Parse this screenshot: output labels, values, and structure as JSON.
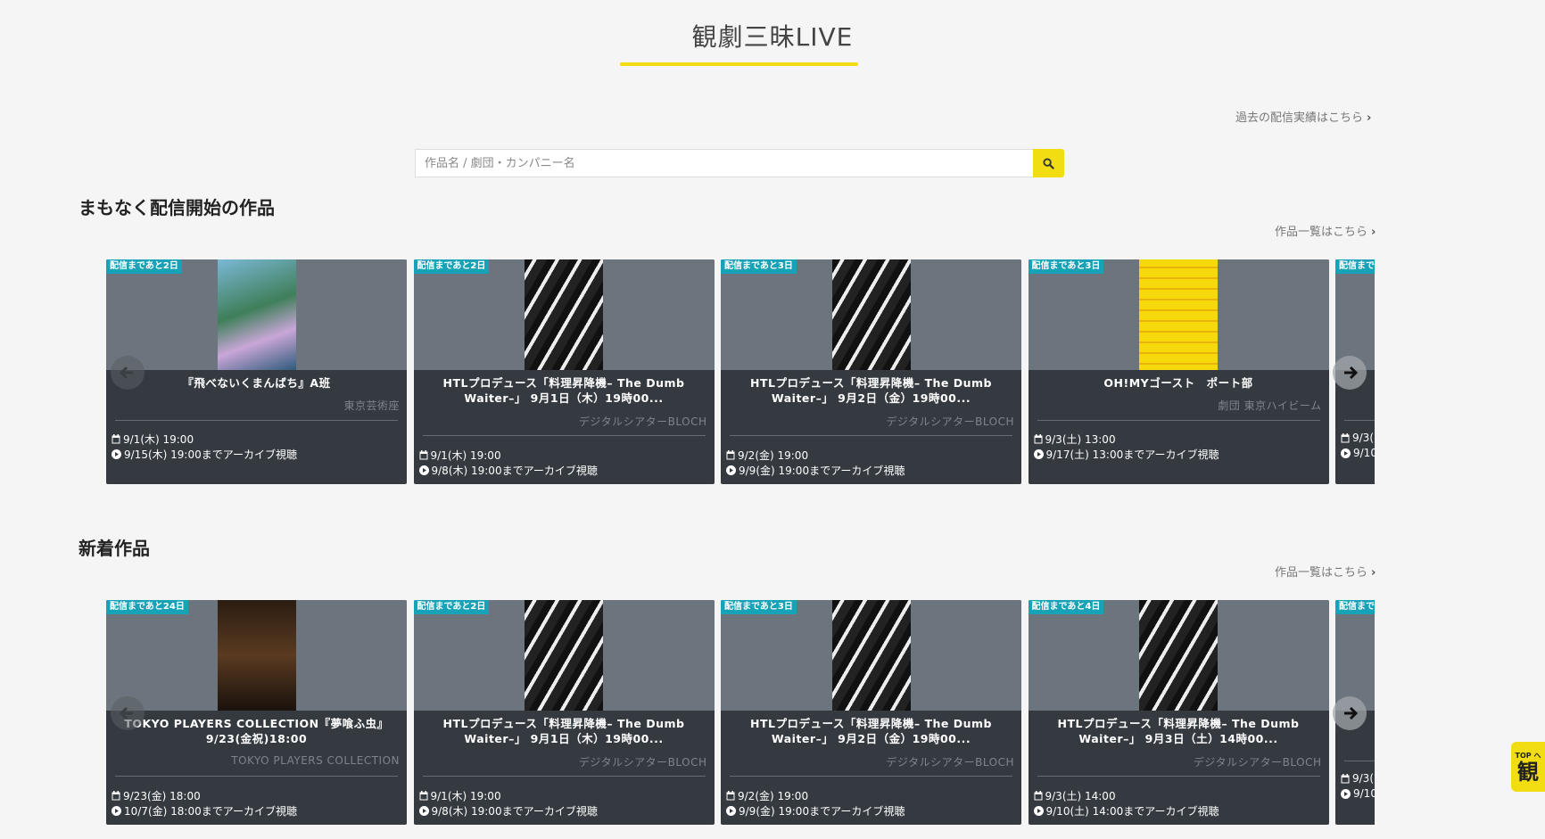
{
  "header": {
    "title": "観劇三昧LIVE",
    "past_link": "過去の配信実績はこちら"
  },
  "search": {
    "placeholder": "作品名 / 劇団・カンパニー名"
  },
  "sections": [
    {
      "title": "まもなく配信開始の作品",
      "more_link": "作品一覧はこちら",
      "cards": [
        {
          "badge": "配信まであと2日",
          "title": "『飛べないくまんばち』A班",
          "company": "東京芸術座",
          "date": "9/1(木) 19:00",
          "archive": "9/15(木) 19:00までアーカイブ視聴"
        },
        {
          "badge": "配信まであと2日",
          "title": "HTLプロデュース「料理昇降機– The Dumb Waiter–」 9月1日（木）19時00...",
          "company": "デジタルシアターBLOCH",
          "date": "9/1(木) 19:00",
          "archive": "9/8(木) 19:00までアーカイブ視聴"
        },
        {
          "badge": "配信まであと3日",
          "title": "HTLプロデュース「料理昇降機– The Dumb Waiter–」 9月2日（金）19時00...",
          "company": "デジタルシアターBLOCH",
          "date": "9/2(金) 19:00",
          "archive": "9/9(金) 19:00までアーカイブ視聴"
        },
        {
          "badge": "配信まであと3日",
          "title": "OH!MYゴースト　ポート部",
          "company": "劇団 東京ハイビーム",
          "date": "9/3(土) 13:00",
          "archive": "9/17(土) 13:00までアーカイブ視聴"
        },
        {
          "badge": "配信まで",
          "title": "HT",
          "company": "",
          "date": "9/3(",
          "archive": "9/10"
        }
      ]
    },
    {
      "title": "新着作品",
      "more_link": "作品一覧はこちら",
      "cards": [
        {
          "badge": "配信まであと24日",
          "title": "TOKYO PLAYERS COLLECTION『夢喰ふ虫』9/23(金祝)18:00",
          "company": "TOKYO PLAYERS COLLECTION",
          "date": "9/23(金) 18:00",
          "archive": "10/7(金) 18:00までアーカイブ視聴"
        },
        {
          "badge": "配信まであと2日",
          "title": "HTLプロデュース「料理昇降機– The Dumb Waiter–」 9月1日（木）19時00...",
          "company": "デジタルシアターBLOCH",
          "date": "9/1(木) 19:00",
          "archive": "9/8(木) 19:00までアーカイブ視聴"
        },
        {
          "badge": "配信まであと3日",
          "title": "HTLプロデュース「料理昇降機– The Dumb Waiter–」 9月2日（金）19時00...",
          "company": "デジタルシアターBLOCH",
          "date": "9/2(金) 19:00",
          "archive": "9/9(金) 19:00までアーカイブ視聴"
        },
        {
          "badge": "配信まであと4日",
          "title": "HTLプロデュース「料理昇降機– The Dumb Waiter–」 9月3日（土）14時00...",
          "company": "デジタルシアターBLOCH",
          "date": "9/3(土) 14:00",
          "archive": "9/10(土) 14:00までアーカイブ視聴"
        },
        {
          "badge": "配信まで",
          "title": "HT",
          "company": "",
          "date": "9/3(",
          "archive": "9/10"
        }
      ]
    }
  ],
  "top_button": {
    "label": "TOP へ",
    "kanji": "観"
  },
  "colors": {
    "accent_yellow": "#f2dc12",
    "badge_teal": "#17a2b8",
    "card_bg": "#343a40",
    "card_top_bg": "#6c757d"
  },
  "icons": {
    "search": "search-icon",
    "calendar": "calendar-icon",
    "play": "play-circle-icon",
    "prev": "arrow-left-icon",
    "next": "arrow-right-icon",
    "chevron": "chevron-right-icon"
  }
}
